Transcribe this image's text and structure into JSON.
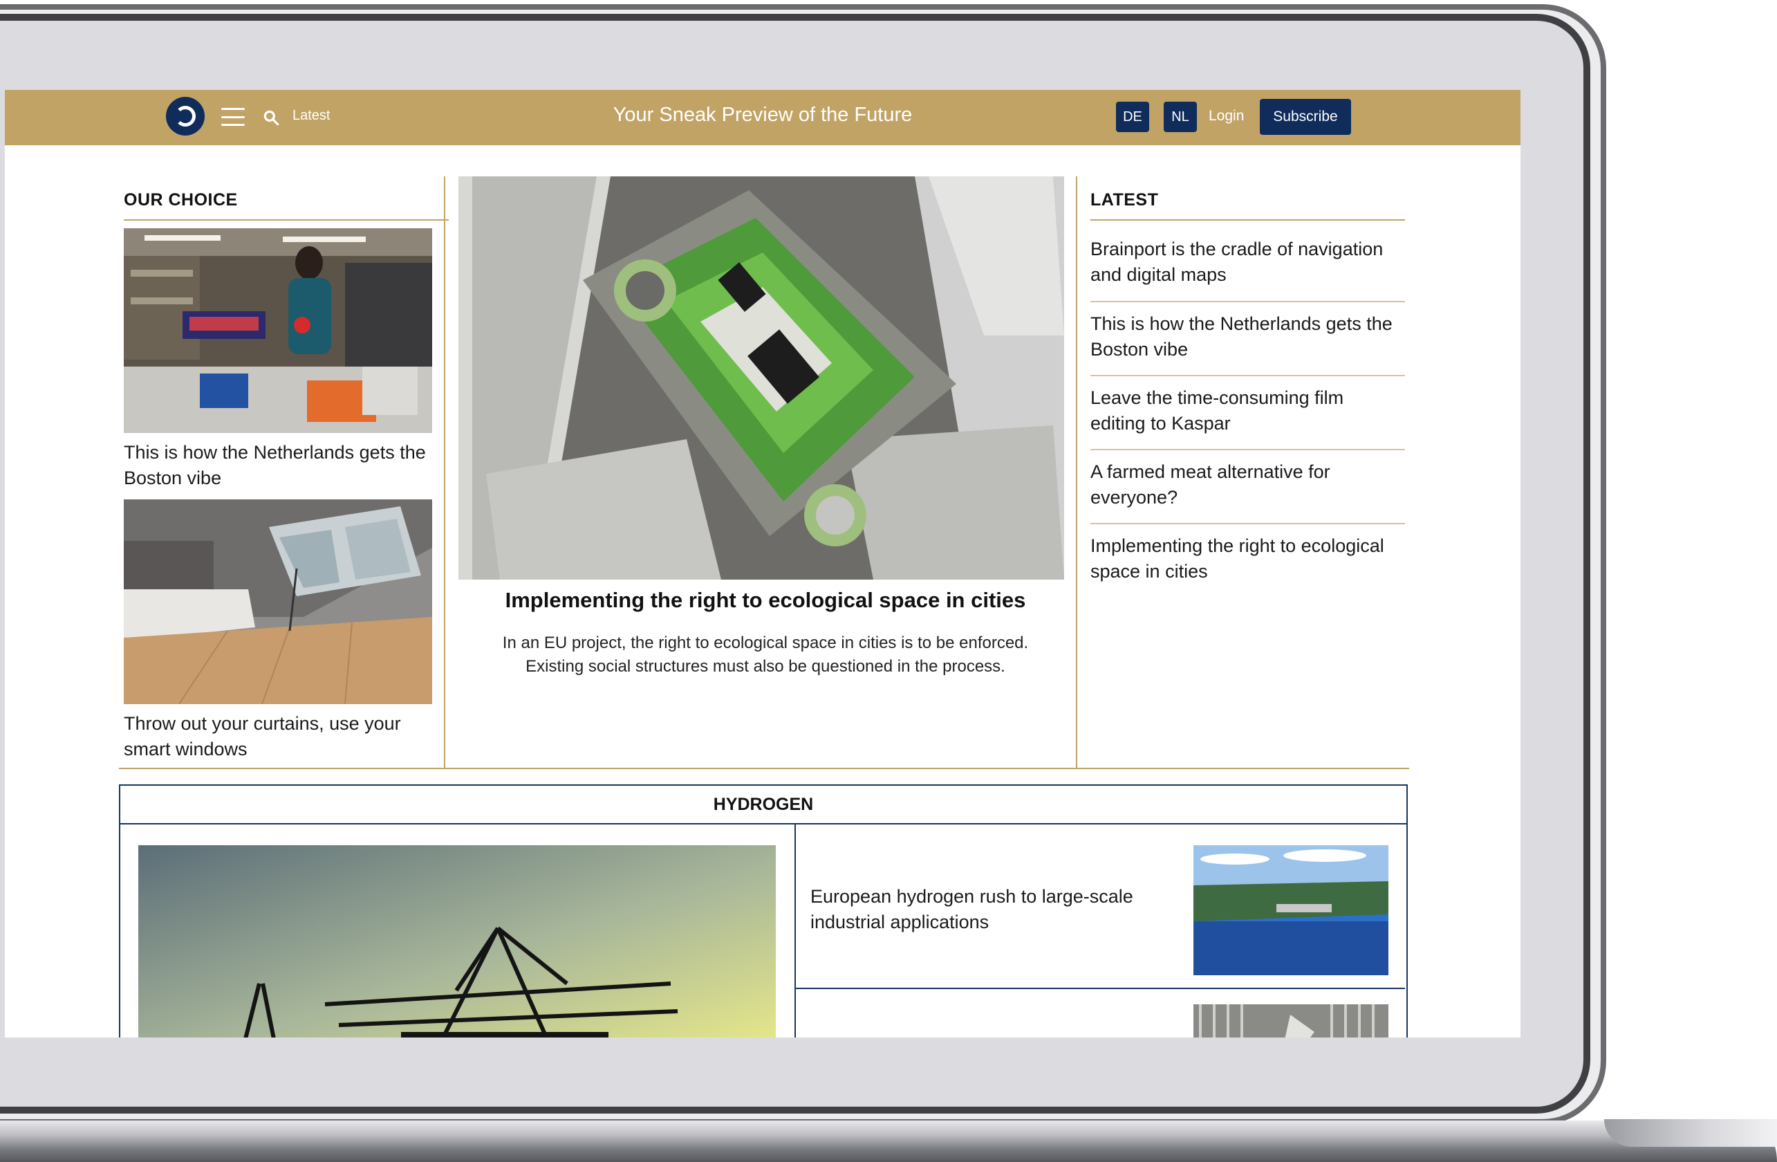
{
  "header": {
    "latest_label": "Latest",
    "tagline": "Your Sneak Preview of the Future",
    "lang_de": "DE",
    "lang_nl": "NL",
    "login_label": "Login",
    "subscribe_label": "Subscribe"
  },
  "our_choice": {
    "title": "OUR CHOICE",
    "items": [
      {
        "caption": "This is how the Netherlands gets the Boston vibe"
      },
      {
        "caption": "Throw out your curtains, use your smart windows"
      }
    ]
  },
  "feature": {
    "title": "Implementing the right to ecological space in cities",
    "description": "In an EU project, the right to ecological space in cities is to be enforced. Existing social structures must also be questioned in the process."
  },
  "latest": {
    "title": "LATEST",
    "items": [
      "Brainport is the cradle of navigation and digital maps",
      "This is how the Netherlands gets the Boston vibe",
      "Leave the time-consuming film editing to Kaspar",
      "A farmed meat alternative for everyone?",
      "Implementing the right to ecological space in cities"
    ]
  },
  "hydrogen": {
    "title": "HYDROGEN",
    "items": [
      "European hydrogen rush to large-scale industrial applications"
    ]
  },
  "colors": {
    "header_gold": "#c2a366",
    "navy": "#0f2c5a",
    "border_navy": "#17355f"
  },
  "icons": [
    "logo-icon",
    "menu-icon",
    "search-icon"
  ]
}
